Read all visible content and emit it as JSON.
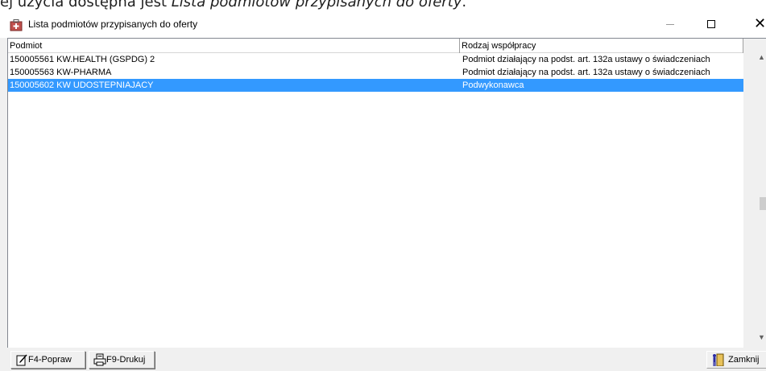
{
  "doc_caption": {
    "prefix": "ej użycia dostępna jest ",
    "emphasis": "Lista podmiotów przypisanych do oferty",
    "suffix": "."
  },
  "window": {
    "title": "Lista podmiotów przypisanych do oferty",
    "close_glyph": "✕"
  },
  "table": {
    "columns": [
      "Podmiot",
      "Rodzaj współpracy"
    ],
    "rows": [
      {
        "podmiot": "150005561 KW.HEALTH (GSPDG) 2",
        "rodzaj": "Podmiot działający na podst. art. 132a ustawy o świadczeniach",
        "selected": false
      },
      {
        "podmiot": "150005563 KW-PHARMA",
        "rodzaj": "Podmiot działający na podst. art. 132a ustawy o świadczeniach",
        "selected": false
      },
      {
        "podmiot": "150005602 KW UDOSTEPNIAJACY",
        "rodzaj": "Podwykonawca",
        "selected": true
      }
    ]
  },
  "toolbar": {
    "edit_label": "F4-Popraw",
    "print_label": "F9-Drukuj",
    "close_label": "Zamknij"
  },
  "icons": {
    "app": "medical-case-icon",
    "edit": "edit-document-icon",
    "print": "printer-icon",
    "close": "exit-door-icon"
  },
  "colors": {
    "selection": "#3399ff",
    "selection_text": "#ffffff"
  }
}
